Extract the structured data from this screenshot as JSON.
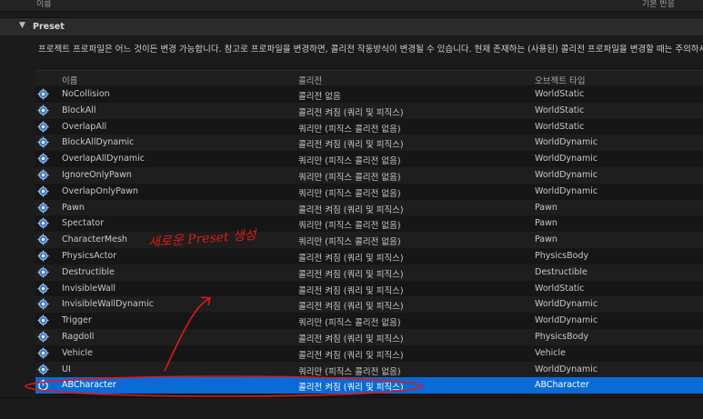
{
  "topstrip": {
    "left_label": "이름",
    "right_label": "기본 반응"
  },
  "section": {
    "title": "Preset",
    "toggle": "▼"
  },
  "description": "프로젝트 프로파일은 어느 것이든 변경 가능합니다. 참고로 프로파일을 변경하면, 콜리전 작동방식이 변경될 수 있습니다. 현재 존재하는 (사용된) 콜리전 프로파일을 변경할 때는 주의하세요.",
  "columns": {
    "name": "이름",
    "collision": "콜리전",
    "object_type": "오브젝트 타입"
  },
  "rows": [
    {
      "name": "NoCollision",
      "collision": "콜리전 없음",
      "object_type": "WorldStatic"
    },
    {
      "name": "BlockAll",
      "collision": "콜리전 켜짐 (쿼리 및 피직스)",
      "object_type": "WorldStatic"
    },
    {
      "name": "OverlapAll",
      "collision": "쿼리만 (피직스 콜리전 없음)",
      "object_type": "WorldStatic"
    },
    {
      "name": "BlockAllDynamic",
      "collision": "콜리전 켜짐 (쿼리 및 피직스)",
      "object_type": "WorldDynamic"
    },
    {
      "name": "OverlapAllDynamic",
      "collision": "쿼리만 (피직스 콜리전 없음)",
      "object_type": "WorldDynamic"
    },
    {
      "name": "IgnoreOnlyPawn",
      "collision": "쿼리만 (피직스 콜리전 없음)",
      "object_type": "WorldDynamic"
    },
    {
      "name": "OverlapOnlyPawn",
      "collision": "쿼리만 (피직스 콜리전 없음)",
      "object_type": "WorldDynamic"
    },
    {
      "name": "Pawn",
      "collision": "콜리전 켜짐 (쿼리 및 피직스)",
      "object_type": "Pawn"
    },
    {
      "name": "Spectator",
      "collision": "쿼리만 (피직스 콜리전 없음)",
      "object_type": "Pawn"
    },
    {
      "name": "CharacterMesh",
      "collision": "쿼리만 (피직스 콜리전 없음)",
      "object_type": "Pawn"
    },
    {
      "name": "PhysicsActor",
      "collision": "콜리전 켜짐 (쿼리 및 피직스)",
      "object_type": "PhysicsBody"
    },
    {
      "name": "Destructible",
      "collision": "콜리전 켜짐 (쿼리 및 피직스)",
      "object_type": "Destructible"
    },
    {
      "name": "InvisibleWall",
      "collision": "콜리전 켜짐 (쿼리 및 피직스)",
      "object_type": "WorldStatic"
    },
    {
      "name": "InvisibleWallDynamic",
      "collision": "콜리전 켜짐 (쿼리 및 피직스)",
      "object_type": "WorldDynamic"
    },
    {
      "name": "Trigger",
      "collision": "쿼리만 (피직스 콜리전 없음)",
      "object_type": "WorldDynamic"
    },
    {
      "name": "Ragdoll",
      "collision": "콜리전 켜짐 (쿼리 및 피직스)",
      "object_type": "PhysicsBody"
    },
    {
      "name": "Vehicle",
      "collision": "콜리전 켜짐 (쿼리 및 피직스)",
      "object_type": "Vehicle"
    },
    {
      "name": "UI",
      "collision": "쿼리만 (피직스 콜리전 없음)",
      "object_type": "WorldDynamic"
    },
    {
      "name": "ABCharacter",
      "collision": "콜리전 켜짐 (쿼리 및 피직스)",
      "object_type": "ABCharacter"
    }
  ],
  "selected_row": "ABCharacter",
  "annotation": {
    "text": "새로운 Preset 생성",
    "color": "#e01818"
  },
  "colors": {
    "selection": "#0a6ad6",
    "background": "#1b1b1b"
  },
  "icons": {
    "preset_row": "gear-icon",
    "custom_row": "stopwatch-icon"
  }
}
